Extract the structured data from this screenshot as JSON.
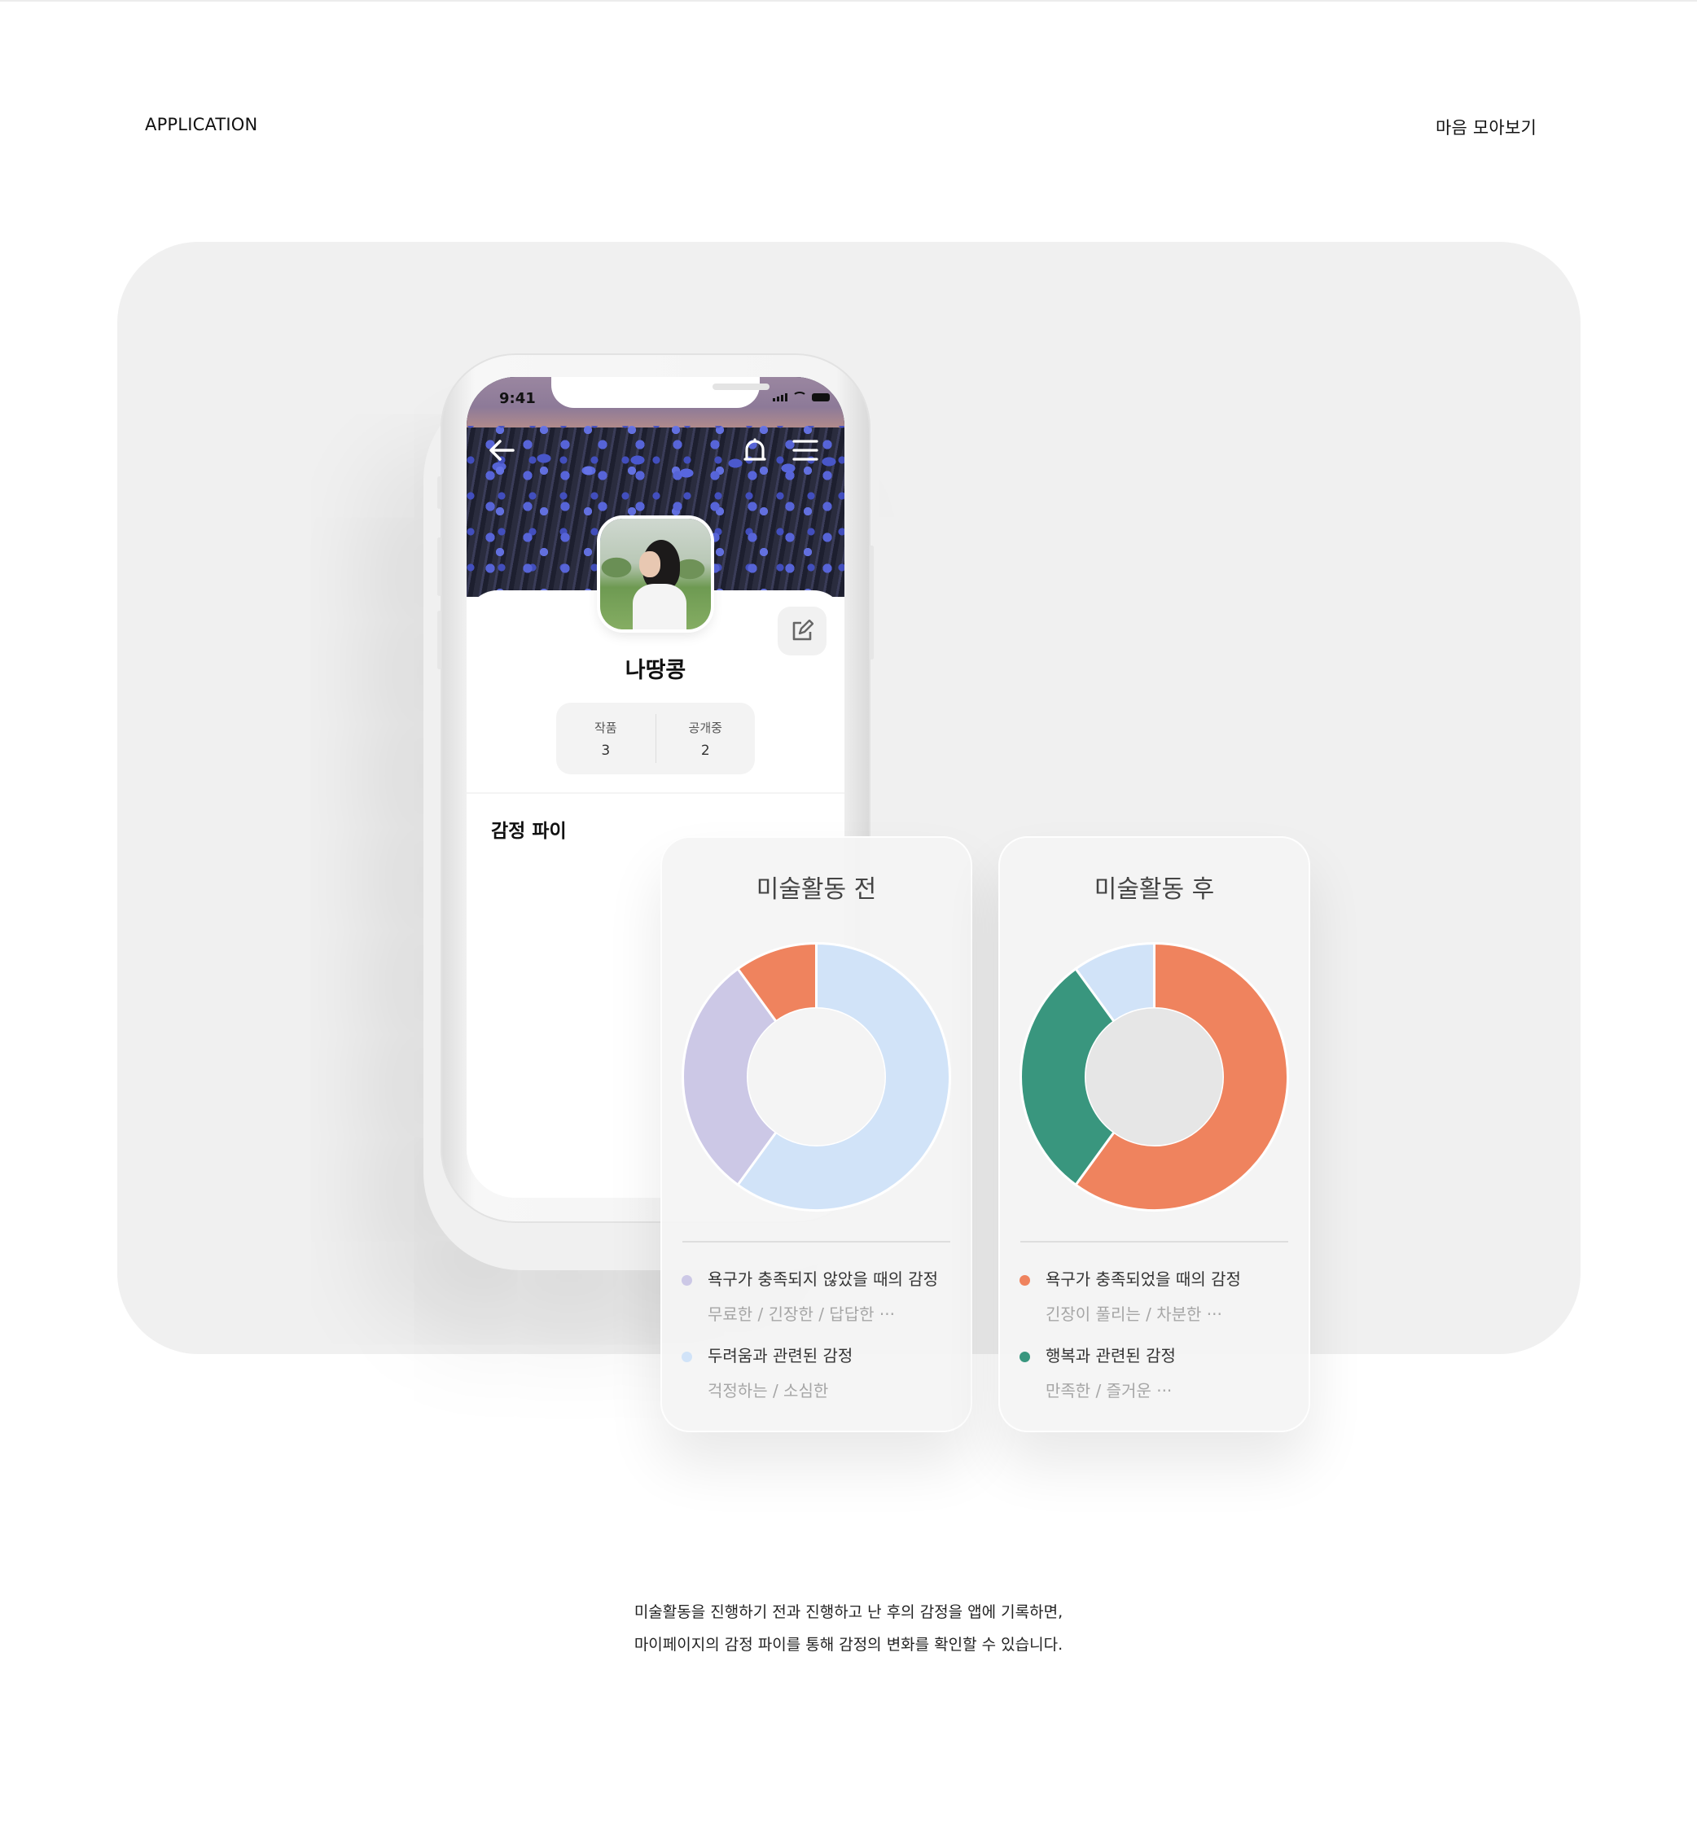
{
  "header": {
    "left": "APPLICATION",
    "right": "마음 모아보기"
  },
  "phone": {
    "time": "9:41",
    "username": "나땅콩",
    "stats": [
      {
        "label": "작품",
        "value": "3"
      },
      {
        "label": "공개중",
        "value": "2"
      }
    ],
    "section_title": "감정 파이"
  },
  "cards": [
    {
      "title": "미술활동 전",
      "legend": [
        {
          "main": "욕구가 충족되지 않았을 때의 감정",
          "sub": "무료한 / 긴장한 / 답답한 ···",
          "color": "#ccc8e6"
        },
        {
          "main": "두려움과 관련된 감정",
          "sub": "걱정하는 / 소심한",
          "color": "#d1e3f8"
        }
      ]
    },
    {
      "title": "미술활동 후",
      "legend": [
        {
          "main": "욕구가 충족되었을 때의 감정",
          "sub": "긴장이 풀리는 / 차분한 ···",
          "color": "#ef835e"
        },
        {
          "main": "행복과 관련된 감정",
          "sub": "만족한 / 즐거운 ···",
          "color": "#39967e"
        }
      ]
    }
  ],
  "chart_data": [
    {
      "type": "pie",
      "title": "미술활동 전",
      "slices": [
        {
          "value": 60,
          "color": "#d1e3f8"
        },
        {
          "value": 30,
          "color": "#ccc8e6"
        },
        {
          "value": 10,
          "color": "#ef835e"
        }
      ]
    },
    {
      "type": "pie",
      "title": "미술활동 후",
      "slices": [
        {
          "value": 60,
          "color": "#ef835e"
        },
        {
          "value": 30,
          "color": "#39967e"
        },
        {
          "value": 10,
          "color": "#d1e3f8"
        }
      ]
    }
  ],
  "caption": {
    "line1": "미술활동을 진행하기 전과 진행하고 난 후의 감정을 앱에 기록하면,",
    "line2": "마이페이지의 감정 파이를 통해 감정의 변화를 확인할 수 있습니다."
  }
}
